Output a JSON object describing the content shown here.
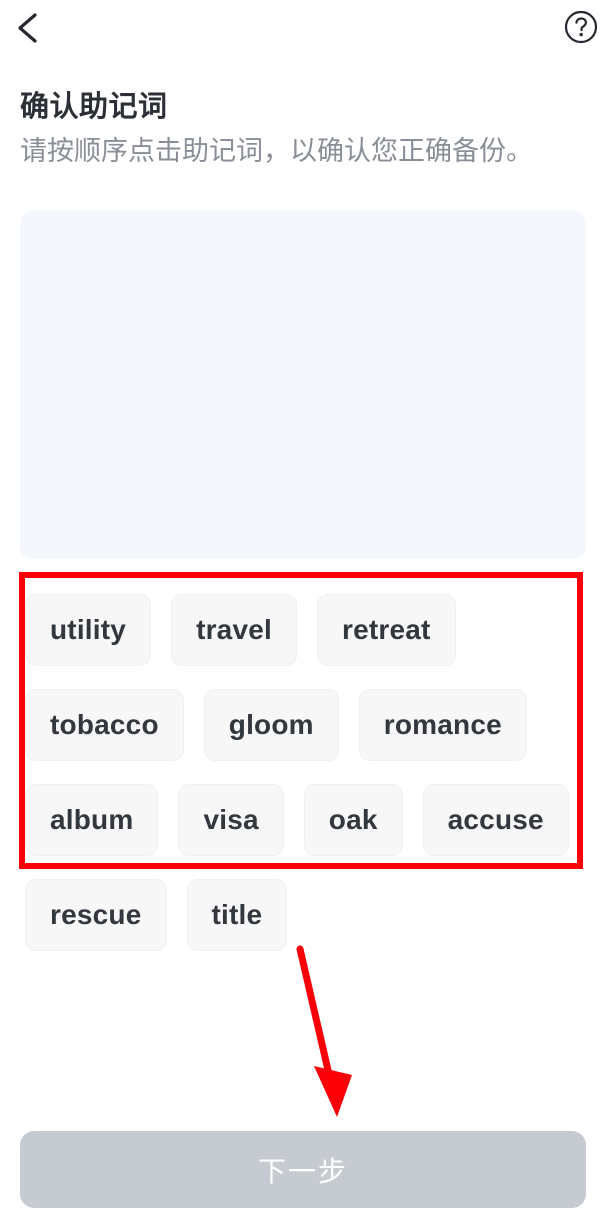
{
  "header": {
    "back_icon": "chevron-left-icon",
    "help_icon": "question-circle-icon"
  },
  "page": {
    "title": "确认助记词",
    "subtitle": "请按顺序点击助记词，以确认您正确备份。"
  },
  "answer_panel": {
    "selected_words": [],
    "background_color": "#f4f8fc"
  },
  "word_pool": {
    "words": [
      "utility",
      "travel",
      "retreat",
      "tobacco",
      "gloom",
      "romance",
      "album",
      "visa",
      "oak",
      "accuse",
      "rescue",
      "title"
    ]
  },
  "annotations": {
    "highlight_color": "#fb0007",
    "highlight_target": "word-pool",
    "arrow_color": "#fb0007",
    "arrow_target": "next-button"
  },
  "footer": {
    "next_label": "下一步",
    "next_disabled": true,
    "next_color": "#c6cbd1"
  }
}
